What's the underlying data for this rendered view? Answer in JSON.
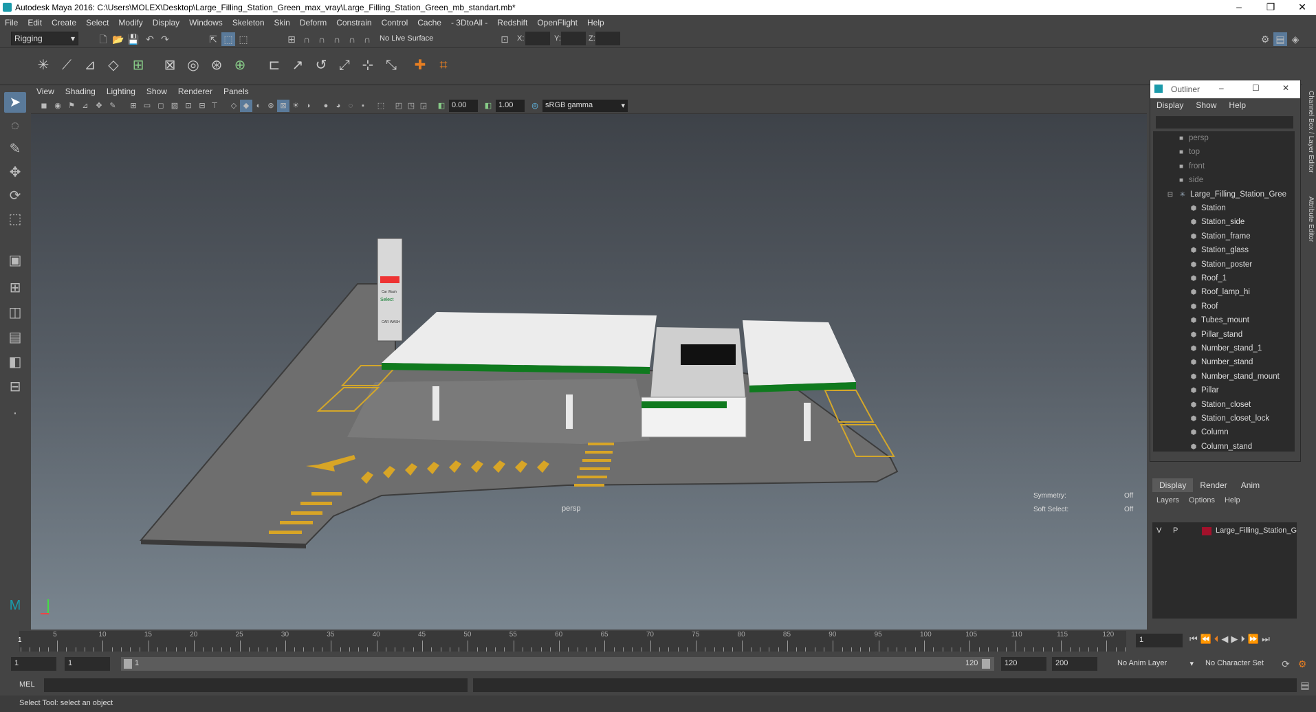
{
  "window": {
    "title": "Autodesk Maya 2016: C:\\Users\\MOLEX\\Desktop\\Large_Filling_Station_Green_max_vray\\Large_Filling_Station_Green_mb_standart.mb*"
  },
  "menubar": [
    "File",
    "Edit",
    "Create",
    "Select",
    "Modify",
    "Display",
    "Windows",
    "Skeleton",
    "Skin",
    "Deform",
    "Constrain",
    "Control",
    "Cache",
    "- 3DtoAll -",
    "Redshift",
    "OpenFlight",
    "Help"
  ],
  "status": {
    "menuset": "Rigging",
    "live_surface": "No Live Surface",
    "x_label": "X:",
    "y_label": "Y:",
    "z_label": "Z:"
  },
  "viewport": {
    "menu": [
      "View",
      "Shading",
      "Lighting",
      "Show",
      "Renderer",
      "Panels"
    ],
    "exposure": "0.00",
    "gamma": "1.00",
    "color_space": "sRGB gamma",
    "camera_label": "persp",
    "symmetry_label": "Symmetry:",
    "symmetry_value": "Off",
    "soft_select_label": "Soft Select:",
    "soft_select_value": "Off"
  },
  "scene": {
    "sign": {
      "line1": "Car Wash",
      "line2": "Select",
      "line3": "CAR WASH"
    }
  },
  "outliner": {
    "title": "Outliner",
    "menu": [
      "Display",
      "Show",
      "Help"
    ],
    "cameras": [
      "persp",
      "top",
      "front",
      "side"
    ],
    "group": "Large_Filling_Station_Gree",
    "items": [
      "Station",
      "Station_side",
      "Station_frame",
      "Station_glass",
      "Station_poster",
      "Roof_1",
      "Roof_lamp_hi",
      "Roof",
      "Tubes_mount",
      "Pillar_stand",
      "Number_stand_1",
      "Number_stand",
      "Number_stand_mount",
      "Pillar",
      "Station_closet",
      "Station_closet_lock",
      "Column",
      "Column_stand"
    ]
  },
  "side_tabs": [
    "Channel Box / Layer Editor",
    "Attribute Editor"
  ],
  "layers": {
    "tabs": [
      "Display",
      "Render",
      "Anim"
    ],
    "menu": [
      "Layers",
      "Options",
      "Help"
    ],
    "row": {
      "v": "V",
      "p": "P",
      "name": "Large_Filling_Station_G",
      "color": "#a3112b"
    }
  },
  "timeline": {
    "ticks": [
      "5",
      "10",
      "15",
      "20",
      "25",
      "30",
      "35",
      "40",
      "45",
      "50",
      "55",
      "60",
      "65",
      "70",
      "75",
      "80",
      "85",
      "90",
      "95",
      "100",
      "105",
      "110",
      "115",
      "120"
    ],
    "start_marker": "1",
    "current_frame": "1"
  },
  "range": {
    "start": "1",
    "playback_start": "1",
    "slider_start": "1",
    "slider_end": "120",
    "playback_end": "120",
    "end": "200",
    "anim_layer": "No Anim Layer",
    "char_set": "No Character Set"
  },
  "cmd": {
    "label": "MEL"
  },
  "help": {
    "text": "Select Tool: select an object"
  }
}
